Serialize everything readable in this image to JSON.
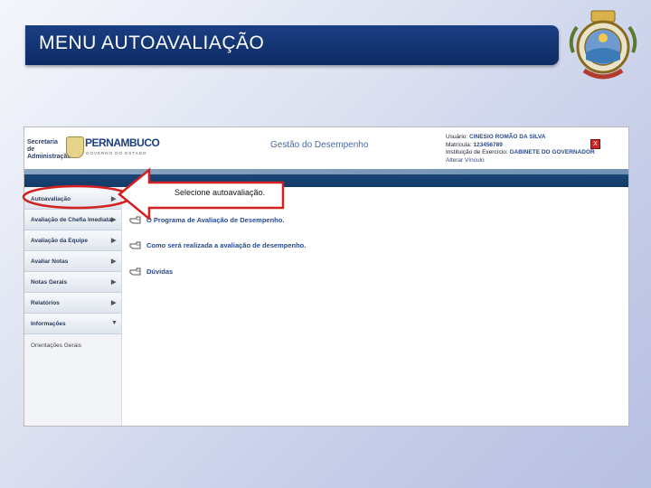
{
  "slide": {
    "title": "MENU AUTOAVALIAÇÃO"
  },
  "app": {
    "org": "Secretaria de Administração",
    "brand_name": "PERNAMBUCO",
    "brand_sub": "GOVERNO DO ESTADO",
    "title": "Gestão do Desempenho",
    "user": {
      "usuario_label": "Usuário:",
      "usuario_value": "CINESIO ROMÃO DA SILVA",
      "matricula_label": "Matrícula:",
      "matricula_value": "123456789",
      "instituicao_label": "Instituição de Exercício:",
      "instituicao_value": "GABINETE DO GOVERNADOR",
      "alterar_vinculo": "Alterar Vínculo"
    },
    "close_label": "X"
  },
  "sidebar": {
    "items": [
      {
        "label": "Autoavaliação",
        "arrow": "▶"
      },
      {
        "label": "Avaliação de Chefia Imediata",
        "arrow": "▶"
      },
      {
        "label": "Avaliação da Equipe",
        "arrow": "▶"
      },
      {
        "label": "Avaliar Notas",
        "arrow": "▶"
      },
      {
        "label": "Notas Gerais",
        "arrow": "▶"
      },
      {
        "label": "Relatórios",
        "arrow": "▶"
      },
      {
        "label": "Informações",
        "arrow": "▼"
      }
    ],
    "sub_item": "Orientações Gerais"
  },
  "content": {
    "links": [
      "O Programa de Avaliação de Desempenho.",
      "Como será realizada a avaliação de desempenho.",
      "Dúvidas"
    ]
  },
  "callout": {
    "text": "Selecione autoavaliação."
  },
  "colors": {
    "title_bar": "#0d2a63",
    "nav_stripe": "#123a68",
    "callout_outline": "#d32020",
    "link": "#274a92"
  }
}
